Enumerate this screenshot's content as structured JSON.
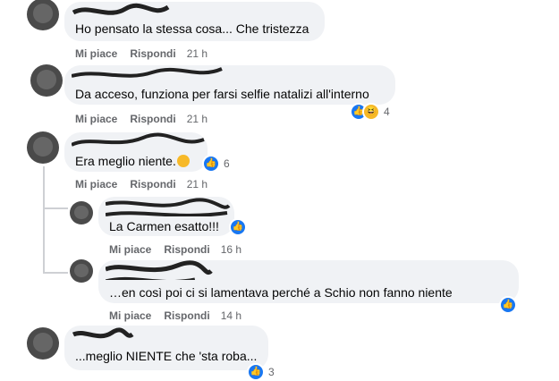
{
  "comments": [
    {
      "text": "Ho pensato la stessa cosa... Che tristezza",
      "actions": {
        "like": "Mi piace",
        "reply": "Rispondi",
        "time": "21 h"
      }
    },
    {
      "text": "Da acceso, funziona per farsi selfie natalizi all'interno",
      "actions": {
        "like": "Mi piace",
        "reply": "Rispondi",
        "time": "21 h"
      },
      "reactions": {
        "count": "4"
      }
    },
    {
      "text": "Era meglio niente.",
      "actions": {
        "like": "Mi piace",
        "reply": "Rispondi",
        "time": "21 h"
      },
      "reactions": {
        "count": "6"
      },
      "replies": [
        {
          "text": "La Carmen esatto!!!",
          "actions": {
            "like": "Mi piace",
            "reply": "Rispondi",
            "time": "16 h"
          }
        },
        {
          "text": "…en così poi ci si lamentava perché a Schio non fanno niente",
          "actions": {
            "like": "Mi piace",
            "reply": "Rispondi",
            "time": "14 h"
          }
        }
      ]
    },
    {
      "text": "...meglio NIENTE che 'sta roba...",
      "reactions": {
        "count": "3"
      }
    }
  ],
  "colors": {
    "bubble": "#f0f2f5",
    "like": "#1877f2",
    "meta": "#65676b"
  }
}
